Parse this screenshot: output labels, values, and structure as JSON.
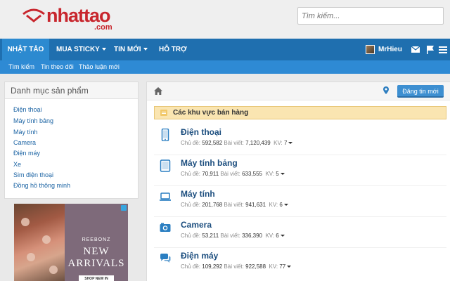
{
  "header": {
    "logo_text": "nhattao",
    "logo_sub": ".com",
    "search_placeholder": "Tìm kiếm..."
  },
  "mainnav": {
    "items": [
      {
        "label": "Nhật Tảo",
        "active": true
      },
      {
        "label": "Mua Sticky",
        "dropdown": true
      },
      {
        "label": "Tin mới",
        "dropdown": true
      },
      {
        "label": "Hỗ trợ"
      }
    ],
    "username": "MrHieu",
    "icons": [
      "mail-icon",
      "flag-icon",
      "menu-icon"
    ]
  },
  "subnav": {
    "items": [
      "Tìm kiếm",
      "Tin theo dõi",
      "Thảo luận mới"
    ]
  },
  "sidebar": {
    "title": "Danh mục sản phẩm",
    "items": [
      "Điện thoại",
      "Máy tính bảng",
      "Máy tính",
      "Camera",
      "Điện máy",
      "Xe",
      "Sim điện thoại",
      "Đồng hồ thông minh"
    ]
  },
  "ad": {
    "brand": "REEBONZ",
    "line1": "NEW",
    "line2": "ARRIVALS",
    "button": "SHOP NEW IN"
  },
  "main": {
    "post_button": "Đăng tin mới",
    "section_title": "Các khu vực bán hàng",
    "stat_labels": {
      "topics": "Chủ đề:",
      "posts": "Bài viết:",
      "kv": "KV:"
    },
    "categories": [
      {
        "title": "Điện thoại",
        "topics": "592,582",
        "posts": "7,120,439",
        "kv": "7",
        "icon": "phone-icon"
      },
      {
        "title": "Máy tính bảng",
        "topics": "70,911",
        "posts": "633,555",
        "kv": "5",
        "icon": "tablet-icon"
      },
      {
        "title": "Máy tính",
        "topics": "201,768",
        "posts": "941,631",
        "kv": "6",
        "icon": "laptop-icon"
      },
      {
        "title": "Camera",
        "topics": "53,211",
        "posts": "336,390",
        "kv": "6",
        "icon": "camera-icon"
      },
      {
        "title": "Điện máy",
        "topics": "109,292",
        "posts": "922,588",
        "kv": "77",
        "icon": "chat-icon"
      }
    ]
  },
  "colors": {
    "nav": "#1f6faf",
    "subnav": "#2e8ad4",
    "brand": "#c8262d",
    "link": "#1c64a4",
    "section_bg": "#fae5b1"
  }
}
